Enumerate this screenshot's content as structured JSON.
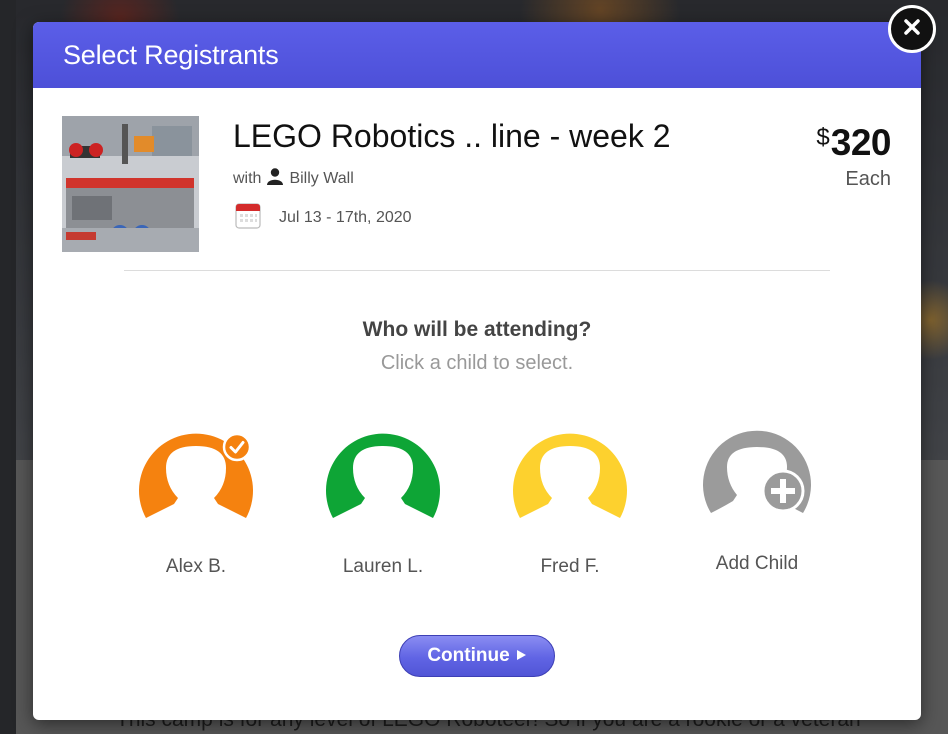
{
  "background": {
    "description_text": "This camp is for any level of LEGO Roboteer! So if you are a rookie or a veteran"
  },
  "modal": {
    "title": "Select Registrants",
    "close_icon": "close-icon"
  },
  "course": {
    "title": "LEGO Robotics .. line - week 2",
    "instructor_prefix": "with",
    "instructor_name": "Billy Wall",
    "dates": "Jul 13 - 17th, 2020",
    "price_currency": "$",
    "price_amount": "320",
    "price_unit": "Each"
  },
  "attendance": {
    "question": "Who will be attending?",
    "hint": "Click a child to select.",
    "children": [
      {
        "name": "Alex B.",
        "color": "#f5820f",
        "selected": true
      },
      {
        "name": "Lauren L.",
        "color": "#0ea536",
        "selected": false
      },
      {
        "name": "Fred F.",
        "color": "#fdd12e",
        "selected": false
      }
    ],
    "add_child_label": "Add Child",
    "add_child_color": "#9b9b9b"
  },
  "actions": {
    "continue_label": "Continue"
  },
  "colors": {
    "header": "#5357e0",
    "accent": "#6064e4"
  }
}
